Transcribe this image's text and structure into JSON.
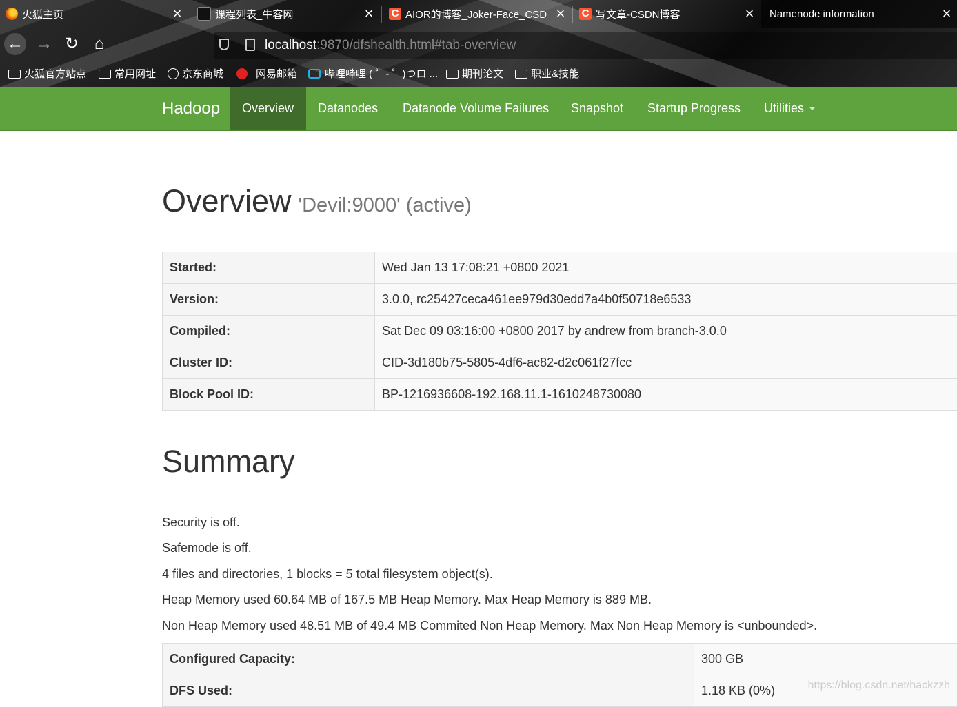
{
  "browser": {
    "tabs": [
      {
        "title": "火狐主页",
        "favicon_color": "#e66000"
      },
      {
        "title": "课程列表_牛客网",
        "favicon_color": "#222222"
      },
      {
        "title": "AIOR的博客_Joker-Face_CSD",
        "favicon_color": "#fc5531"
      },
      {
        "title": "写文章-CSDN博客",
        "favicon_color": "#fc5531"
      },
      {
        "title": "Namenode information",
        "favicon_color": ""
      }
    ],
    "url": {
      "host": "localhost",
      "rest": ":9870/dfshealth.html#tab-overview"
    },
    "bookmarks": [
      {
        "label": "火狐官方站点",
        "icon": "folder-icon"
      },
      {
        "label": "常用网址",
        "icon": "folder-icon"
      },
      {
        "label": "京东商城",
        "icon": "globe-icon"
      },
      {
        "label": "网易邮箱",
        "icon": "netease-icon"
      },
      {
        "label": "哔哩哔哩 ( ゜- ゜)つロ ...",
        "icon": "bilibili-icon"
      },
      {
        "label": "期刊论文",
        "icon": "folder-icon"
      },
      {
        "label": "职业&技能",
        "icon": "folder-icon"
      }
    ]
  },
  "hadoop_nav": {
    "brand": "Hadoop",
    "items": [
      "Overview",
      "Datanodes",
      "Datanode Volume Failures",
      "Snapshot",
      "Startup Progress",
      "Utilities"
    ],
    "active": "Overview",
    "color": "#5fa33e",
    "active_color": "#3f6c2a"
  },
  "overview": {
    "title": "Overview",
    "subtitle": "'Devil:9000' (active)",
    "rows": [
      {
        "label": "Started:",
        "value": "Wed Jan 13 17:08:21 +0800 2021"
      },
      {
        "label": "Version:",
        "value": "3.0.0, rc25427ceca461ee979d30edd7a4b0f50718e6533"
      },
      {
        "label": "Compiled:",
        "value": "Sat Dec 09 03:16:00 +0800 2017 by andrew from branch-3.0.0"
      },
      {
        "label": "Cluster ID:",
        "value": "CID-3d180b75-5805-4df6-ac82-d2c061f27fcc"
      },
      {
        "label": "Block Pool ID:",
        "value": "BP-1216936608-192.168.11.1-1610248730080"
      }
    ]
  },
  "summary": {
    "title": "Summary",
    "lines": [
      "Security is off.",
      "Safemode is off.",
      "4 files and directories, 1 blocks = 5 total filesystem object(s).",
      "Heap Memory used 60.64 MB of 167.5 MB Heap Memory. Max Heap Memory is 889 MB.",
      "Non Heap Memory used 48.51 MB of 49.4 MB Commited Non Heap Memory. Max Non Heap Memory is <unbounded>."
    ],
    "rows": [
      {
        "label": "Configured Capacity:",
        "value": "300 GB"
      },
      {
        "label": "DFS Used:",
        "value": "1.18 KB (0%)"
      }
    ]
  },
  "watermark": "https://blog.csdn.net/hackzzh"
}
